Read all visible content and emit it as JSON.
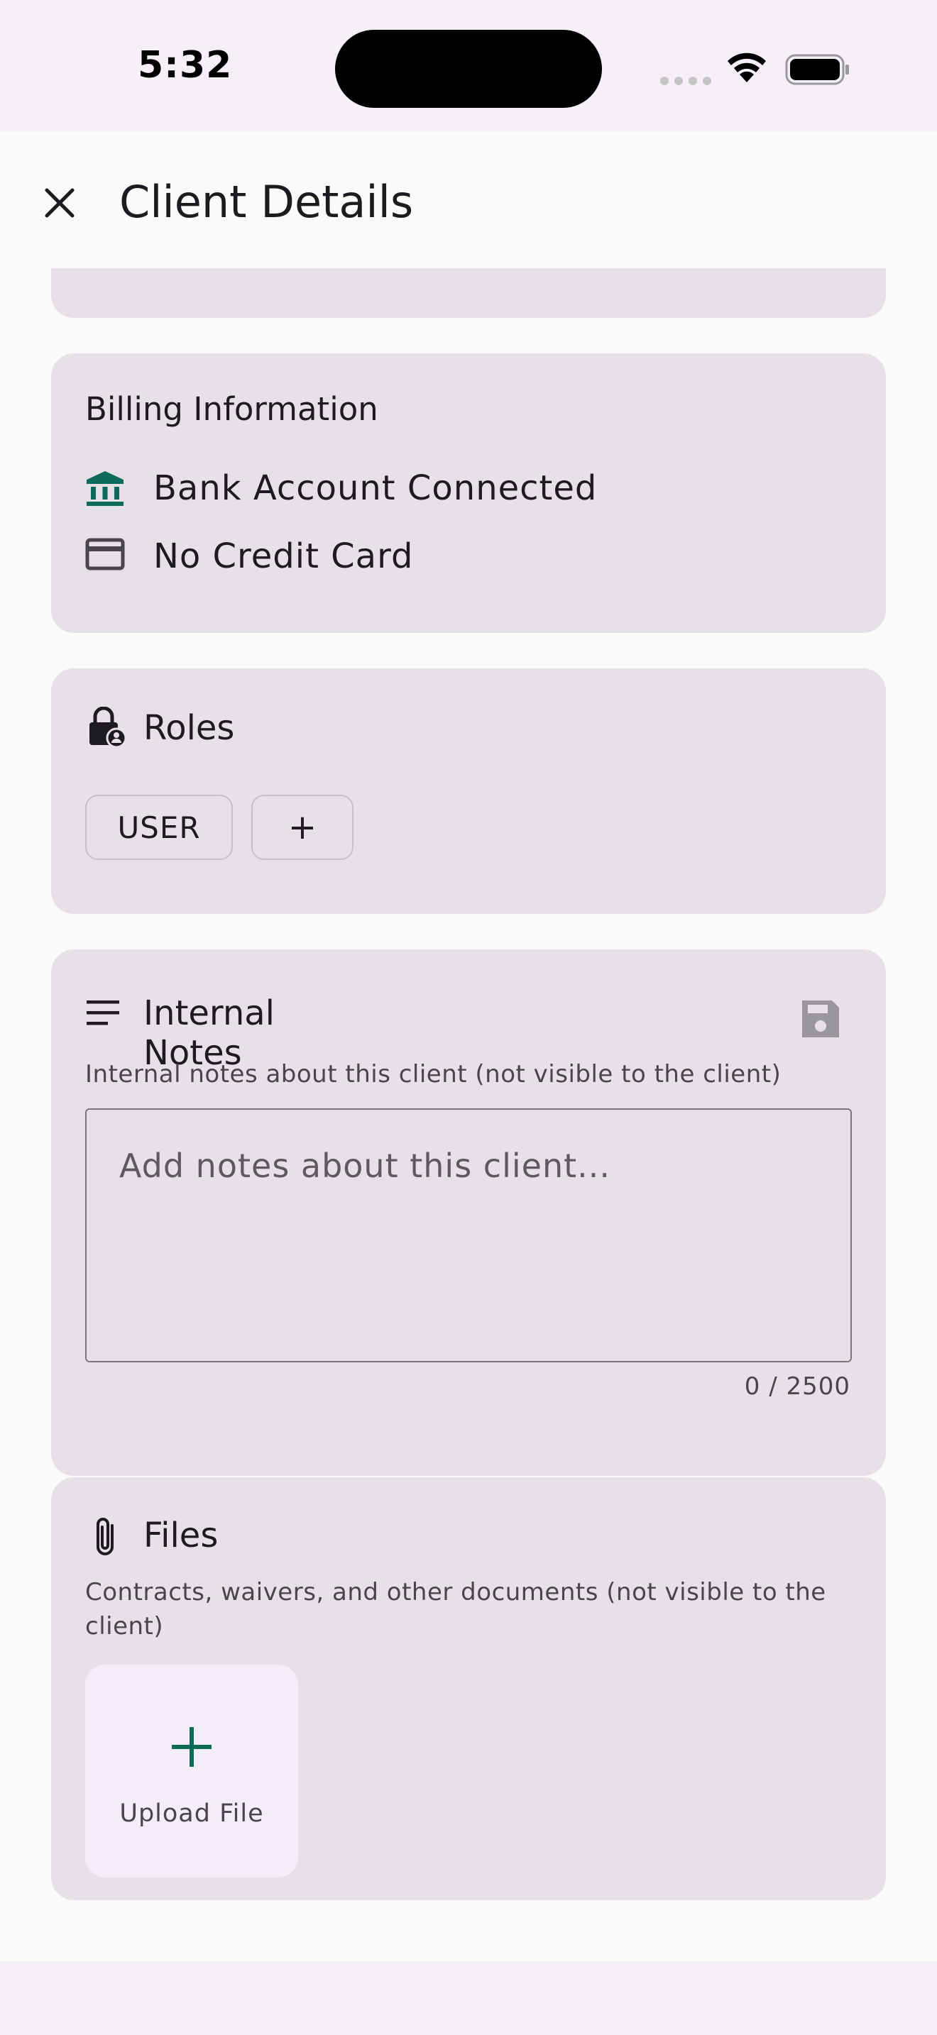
{
  "status_bar": {
    "time": "5:32"
  },
  "app_bar": {
    "title": "Client Details",
    "close_icon": "close-icon"
  },
  "billing": {
    "title": "Billing Information",
    "bank_label": "Bank Account Connected",
    "card_label": "No Credit Card",
    "bank_icon_color": "#0d6b5a"
  },
  "roles": {
    "title": "Roles",
    "chips": [
      "USER"
    ],
    "add_label": "+"
  },
  "notes": {
    "title": "Internal Notes",
    "subtitle": "Internal notes about this client (not visible to the client)",
    "placeholder": "Add notes about this client...",
    "value": "",
    "counter": "0 / 2500"
  },
  "files": {
    "title": "Files",
    "subtitle": "Contracts, waivers, and other documents (not visible to the client)",
    "upload_label": "Upload File",
    "accent": "#0d6b5a"
  }
}
